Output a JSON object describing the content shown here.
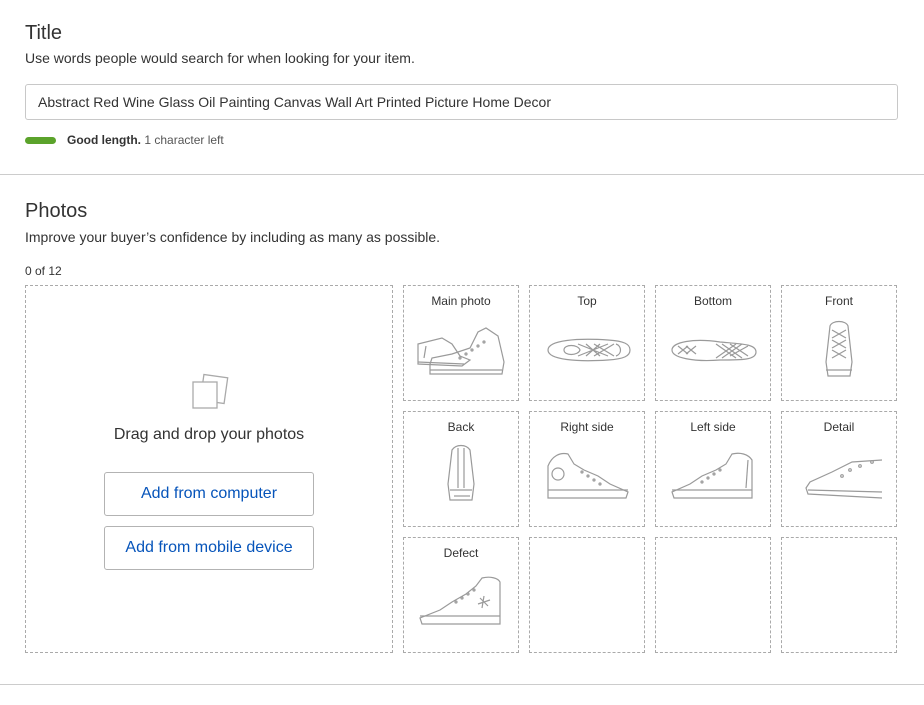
{
  "title_section": {
    "heading": "Title",
    "description": "Use words people would search for when looking for your item.",
    "input_value": "Abstract Red Wine Glass Oil Painting Canvas Wall Art Printed Picture Home Decor",
    "length_status": "Good length.",
    "length_remaining": "1 character left",
    "length_bar_fraction": 0.99,
    "length_bar_color": "#5ba32b"
  },
  "photos_section": {
    "heading": "Photos",
    "description": "Improve your buyer’s confidence by including as many as possible.",
    "count": "0 of 12",
    "dropzone": {
      "text": "Drag and drop your photos",
      "add_computer_label": "Add from computer",
      "add_mobile_label": "Add from mobile device",
      "icon": "photo-stack-icon"
    },
    "slots": [
      {
        "label": "Main photo",
        "icon": "sneaker-pair-icon"
      },
      {
        "label": "Top",
        "icon": "sneaker-top-icon"
      },
      {
        "label": "Bottom",
        "icon": "sneaker-sole-icon"
      },
      {
        "label": "Front",
        "icon": "sneaker-front-icon"
      },
      {
        "label": "Back",
        "icon": "sneaker-back-icon"
      },
      {
        "label": "Right side",
        "icon": "sneaker-right-side-icon"
      },
      {
        "label": "Left side",
        "icon": "sneaker-left-side-icon"
      },
      {
        "label": "Detail",
        "icon": "sneaker-detail-icon"
      },
      {
        "label": "Defect",
        "icon": "sneaker-defect-icon"
      },
      {
        "label": "",
        "icon": ""
      },
      {
        "label": "",
        "icon": ""
      },
      {
        "label": "",
        "icon": ""
      }
    ]
  },
  "colors": {
    "link_blue": "#0654ba",
    "border_gray": "#aaaaaa",
    "success_green": "#5ba32b"
  }
}
